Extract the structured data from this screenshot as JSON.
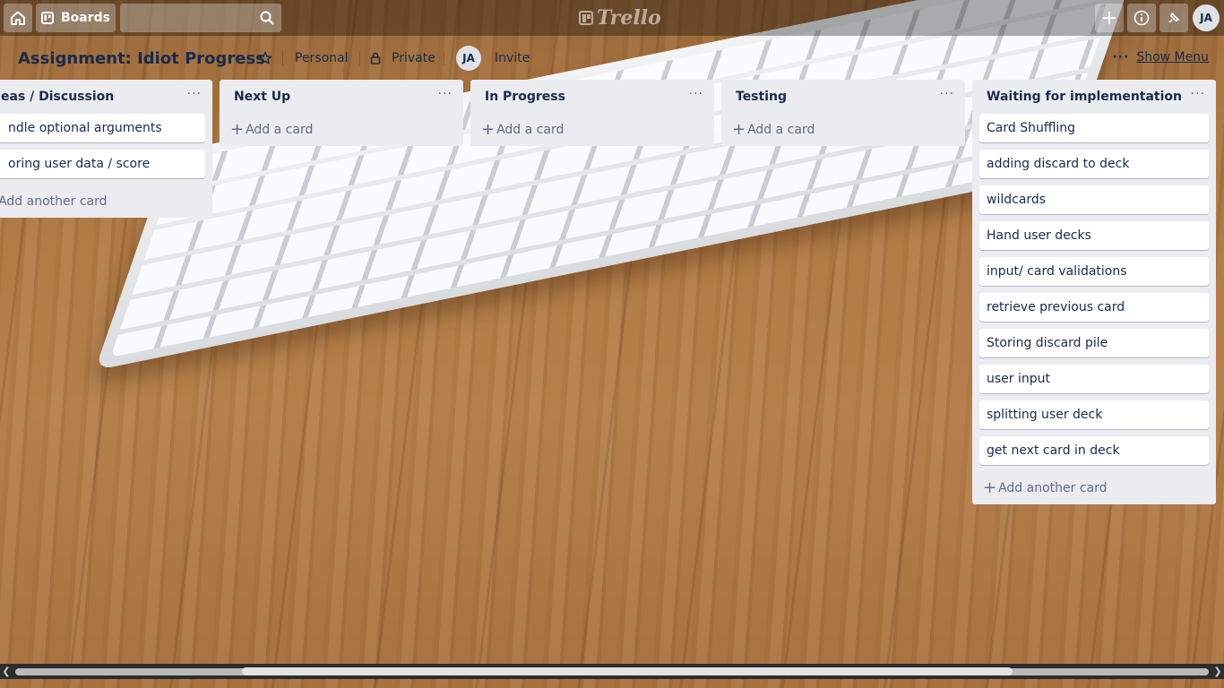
{
  "topbar": {
    "boards_label": "Boards",
    "search_placeholder": "",
    "logo_text": "Trello",
    "user_initials": "JA",
    "icons": [
      "home-icon",
      "boards-icon",
      "search-icon",
      "plus-icon",
      "info-icon",
      "notification-icon"
    ]
  },
  "board": {
    "title": "Assignment: Idiot Progress",
    "team": "Personal",
    "visibility": "Private",
    "member_initials": "JA",
    "invite_label": "Invite",
    "show_menu_label": "Show Menu"
  },
  "lists": [
    {
      "title": "eas / Discussion",
      "cards": [
        "ndle optional arguments",
        "oring user data / score"
      ],
      "add_label": "Add another card"
    },
    {
      "title": "Next Up",
      "cards": [],
      "add_label": "Add a card"
    },
    {
      "title": "In Progress",
      "cards": [],
      "add_label": "Add a card"
    },
    {
      "title": "Testing",
      "cards": [],
      "add_label": "Add a card"
    },
    {
      "title": "Waiting for implementation",
      "cards": [
        "Card Shuffling",
        "adding discard to deck",
        "wildcards",
        "Hand user decks",
        "input/ card validations",
        "retrieve previous card",
        "Storing discard pile",
        "user input",
        "splitting user deck",
        "get next card in deck"
      ],
      "add_label": "Add another card"
    }
  ],
  "colors": {
    "header_bg": "rgba(0,0,0,0.32)",
    "list_bg": "#ebecf0",
    "card_bg": "#ffffff",
    "text": "#172b4d",
    "muted_text": "#5e6c84"
  }
}
